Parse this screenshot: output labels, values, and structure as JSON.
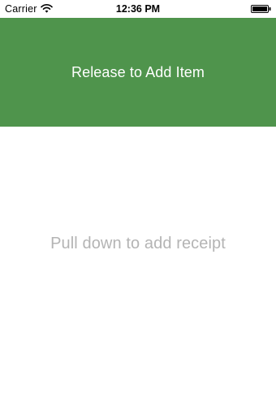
{
  "status_bar": {
    "carrier": "Carrier",
    "time": "12:36 PM",
    "wifi_icon": "wifi-icon",
    "battery_icon": "battery-icon"
  },
  "pull_banner": {
    "label": "Release to Add Item",
    "background_color": "#4f944c"
  },
  "content": {
    "empty_hint": "Pull down to add receipt"
  }
}
